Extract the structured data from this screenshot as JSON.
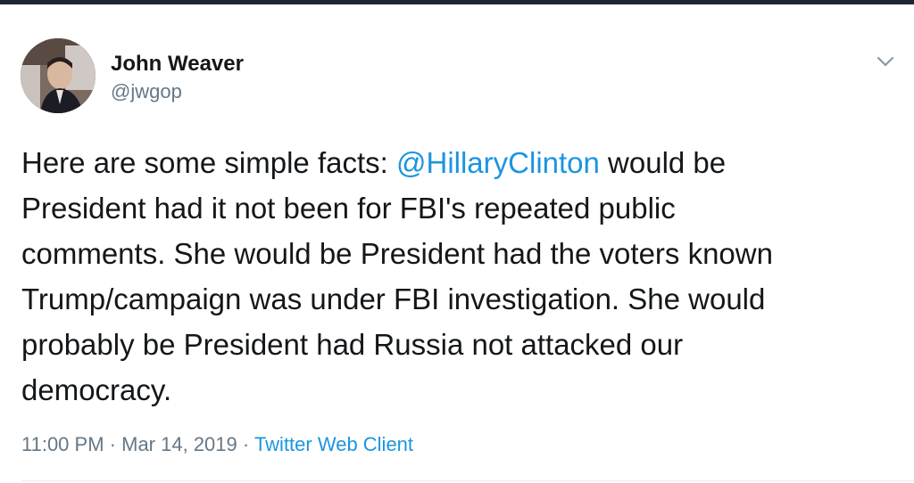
{
  "tweet": {
    "author_name": "John Weaver",
    "author_handle": "@jwgop",
    "text_lines": [
      {
        "before": "Here are some simple facts: ",
        "mention": "@HillaryClinton",
        "after": " would be"
      },
      "President had it not been for FBI's repeated public",
      "comments. She would be President had the voters known",
      "Trump/campaign was under FBI investigation. She would",
      "probably be President had Russia not attacked our",
      "democracy."
    ],
    "time": "11:00 PM",
    "date": "Mar 14, 2019",
    "separator": "·",
    "source": "Twitter Web Client",
    "menu_icon": "chevron-down-icon",
    "avatar_icon": "profile-photo"
  },
  "colors": {
    "text": "#14171a",
    "secondary": "#657786",
    "link": "#1b95e0",
    "top_bar": "#1d2733"
  }
}
